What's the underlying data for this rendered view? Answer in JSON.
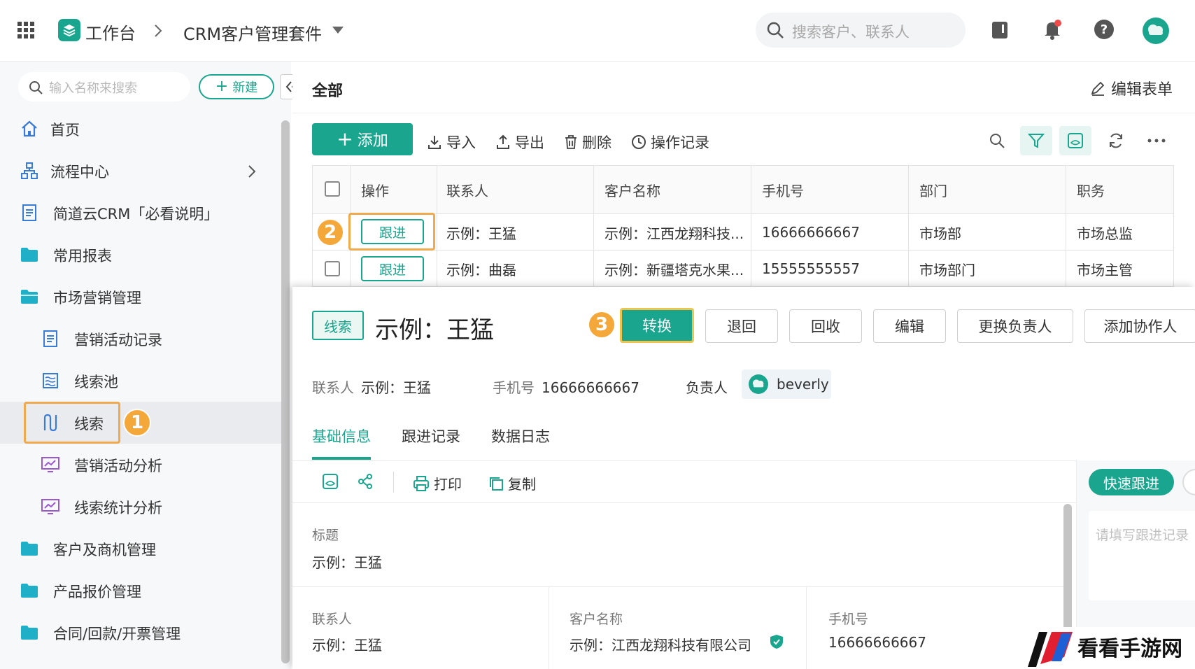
{
  "topbar": {
    "workbench": "工作台",
    "app_name": "CRM客户管理套件",
    "search_placeholder": "搜索客户、联系人"
  },
  "sidebar": {
    "search_placeholder": "输入名称来搜索",
    "new_label": "新建",
    "items": [
      {
        "label": "首页",
        "icon": "home-icon"
      },
      {
        "label": "流程中心",
        "icon": "org-chart-icon"
      },
      {
        "label": "简道云CRM「必看说明」",
        "icon": "document-icon"
      },
      {
        "label": "常用报表",
        "icon": "folder-icon"
      },
      {
        "label": "市场营销管理",
        "icon": "folder-icon"
      },
      {
        "label": "营销活动记录",
        "icon": "document-icon"
      },
      {
        "label": "线索池",
        "icon": "pool-icon"
      },
      {
        "label": "线索",
        "icon": "lead-icon"
      },
      {
        "label": "营销活动分析",
        "icon": "chart-monitor-icon"
      },
      {
        "label": "线索统计分析",
        "icon": "chart-monitor-icon"
      },
      {
        "label": "客户及商机管理",
        "icon": "folder-icon"
      },
      {
        "label": "产品报价管理",
        "icon": "folder-icon"
      },
      {
        "label": "合同/回款/开票管理",
        "icon": "folder-icon"
      }
    ]
  },
  "badges": {
    "one": "1",
    "two": "2",
    "three": "3"
  },
  "content": {
    "title": "全部",
    "edit_form": "编辑表单"
  },
  "toolbar": {
    "add": "添加",
    "import": "导入",
    "export": "导出",
    "delete": "删除",
    "history": "操作记录"
  },
  "table": {
    "columns": [
      "操作",
      "联系人",
      "客户名称",
      "手机号",
      "部门",
      "职务"
    ],
    "rows": [
      {
        "action": "跟进",
        "contact": "示例：王猛",
        "customer": "示例：江西龙翔科技...",
        "phone": "16666666667",
        "dept": "市场部",
        "title": "市场总监"
      },
      {
        "action": "跟进",
        "contact": "示例：曲磊",
        "customer": "示例：新疆塔克水果...",
        "phone": "15555555557",
        "dept": "市场部门",
        "title": "市场主管"
      }
    ]
  },
  "detail": {
    "tag": "线索",
    "title": "示例：王猛",
    "actions": {
      "convert": "转换",
      "return": "退回",
      "recycle": "回收",
      "edit": "编辑",
      "change_owner": "更换负责人",
      "add_collaborator": "添加协作人"
    },
    "meta": {
      "contact_label": "联系人",
      "contact_value": "示例：王猛",
      "phone_label": "手机号",
      "phone_value": "16666666667",
      "owner_label": "负责人",
      "owner_value": "beverly"
    },
    "tabs": [
      "基础信息",
      "跟进记录",
      "数据日志"
    ],
    "tools": {
      "print": "打印",
      "copy": "复制"
    },
    "quick_follow": "快速跟进",
    "follow_placeholder": "请填写跟进记录",
    "fields": {
      "title_label": "标题",
      "title_value": "示例：王猛",
      "contact_label": "联系人",
      "contact_value": "示例：王猛",
      "customer_label": "客户名称",
      "customer_value": "示例：江西龙翔科技有限公司",
      "phone_label": "手机号",
      "phone_value": "16666666667"
    }
  },
  "watermark": {
    "text": "看看手游网"
  },
  "colors": {
    "accent": "#1aa68e",
    "highlight": "#f0a94d",
    "badge": "#f5a83a"
  }
}
